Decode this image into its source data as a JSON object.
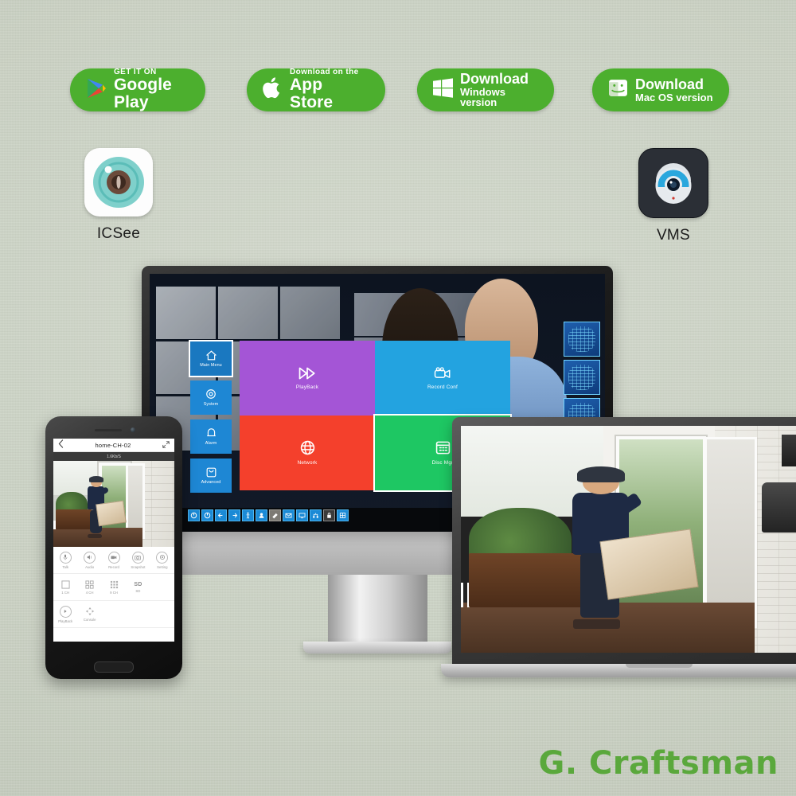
{
  "background": {
    "color": "#ccd3c6",
    "brand_green": "#4CAF2E"
  },
  "store_buttons": [
    {
      "id": "google-play",
      "icon": "google-play-icon",
      "small_label": "GET IT ON",
      "big_label": "Google Play",
      "color": "#4CAF2E"
    },
    {
      "id": "app-store",
      "icon": "apple-logo-icon",
      "small_label": "Download on the",
      "big_label": "App Store",
      "color": "#4CAF2E"
    },
    {
      "id": "windows",
      "icon": "windows-logo-icon",
      "big_label": "Download",
      "sub_label": "Windows version",
      "color": "#4CAF2E"
    },
    {
      "id": "macos",
      "icon": "mac-finder-icon",
      "big_label": "Download",
      "sub_label": "Mac OS version",
      "color": "#4CAF2E"
    }
  ],
  "app_icons": [
    {
      "id": "icsee",
      "name": "ICSee",
      "icon": "camera-lens-icon",
      "tile_color": "#fdfdfd",
      "accent": "#5ec7c2"
    },
    {
      "id": "vms",
      "name": "VMS",
      "icon": "dome-camera-icon",
      "tile_color": "#2b2f36",
      "accent": "#1f9fd6"
    }
  ],
  "monitor": {
    "device": "desktop-monitor",
    "scene": "security-control-room",
    "nvr_ui": {
      "sidebar": [
        {
          "label": "Main Menu",
          "icon": "home-icon",
          "selected": true
        },
        {
          "label": "System",
          "icon": "gear-icon",
          "selected": false
        },
        {
          "label": "Alarm",
          "icon": "bell-icon",
          "selected": false
        },
        {
          "label": "Advanced",
          "icon": "tools-icon",
          "selected": false
        }
      ],
      "tiles": [
        {
          "label": "PlayBack",
          "icon": "fast-forward-icon",
          "color": "#a455d6"
        },
        {
          "label": "Record Conf",
          "icon": "video-camera-icon",
          "color": "#23a3e0"
        },
        {
          "label": "Network",
          "icon": "globe-icon",
          "color": "#f4402c"
        },
        {
          "label": "Disc Mgr",
          "icon": "grid-calendar-icon",
          "color": "#1ec763",
          "selected": true
        }
      ],
      "toolbar_icons": [
        "power-icon",
        "power-icon",
        "back-arrow-icon",
        "forward-arrow-icon",
        "motion-detect-icon",
        "user-icon",
        "ptz-icon",
        "mail-icon",
        "display-icon",
        "network-icon",
        "lock-icon",
        "split-view-icon"
      ]
    }
  },
  "phone": {
    "device": "smartphone",
    "header": {
      "back_icon": "chevron-left-icon",
      "title": "home-CH-02",
      "expand_icon": "fullscreen-icon"
    },
    "bitrate": "1.6Kb/S",
    "scene": "front-door-delivery",
    "controls_row1": [
      {
        "label": "Talk",
        "icon": "microphone-icon"
      },
      {
        "label": "Audio",
        "icon": "speaker-icon"
      },
      {
        "label": "Record",
        "icon": "video-icon"
      },
      {
        "label": "Snapshot",
        "icon": "camera-icon"
      },
      {
        "label": "Setting",
        "icon": "gear-icon"
      }
    ],
    "controls_row2": [
      {
        "label": "1 CH",
        "icon": "single-pane-icon"
      },
      {
        "label": "4 CH",
        "icon": "quad-pane-icon"
      },
      {
        "label": "9 CH",
        "icon": "nine-pane-icon"
      },
      {
        "label": "SD",
        "icon": "quality-text",
        "value": "SD"
      }
    ],
    "controls_row3": [
      {
        "label": "PlayBack",
        "icon": "play-circle-icon"
      },
      {
        "label": "Console",
        "icon": "dpad-icon"
      }
    ]
  },
  "laptop": {
    "device": "laptop",
    "scene": "front-door-delivery"
  },
  "brand": {
    "name": "G. Craftsman",
    "color": "#5aa83c"
  }
}
